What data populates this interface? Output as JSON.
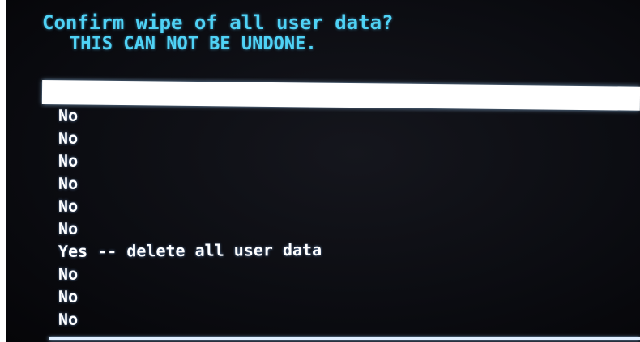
{
  "dialog": {
    "title": "Confirm wipe of all user data?",
    "warning": "THIS CAN NOT BE UNDONE."
  },
  "menu": {
    "items": [
      {
        "label": "",
        "selected": true
      },
      {
        "label": "No",
        "selected": false
      },
      {
        "label": "No",
        "selected": false
      },
      {
        "label": "No",
        "selected": false
      },
      {
        "label": "No",
        "selected": false
      },
      {
        "label": "No",
        "selected": false
      },
      {
        "label": "No",
        "selected": false
      },
      {
        "label": "Yes -- delete all user data",
        "selected": false
      },
      {
        "label": "No",
        "selected": false
      },
      {
        "label": "No",
        "selected": false
      },
      {
        "label": "No",
        "selected": false
      }
    ]
  },
  "colors": {
    "header_text": "#4fd2f5",
    "menu_text": "#ffffff",
    "highlight_bar": "#ffffff",
    "background": "#0b0c11"
  }
}
